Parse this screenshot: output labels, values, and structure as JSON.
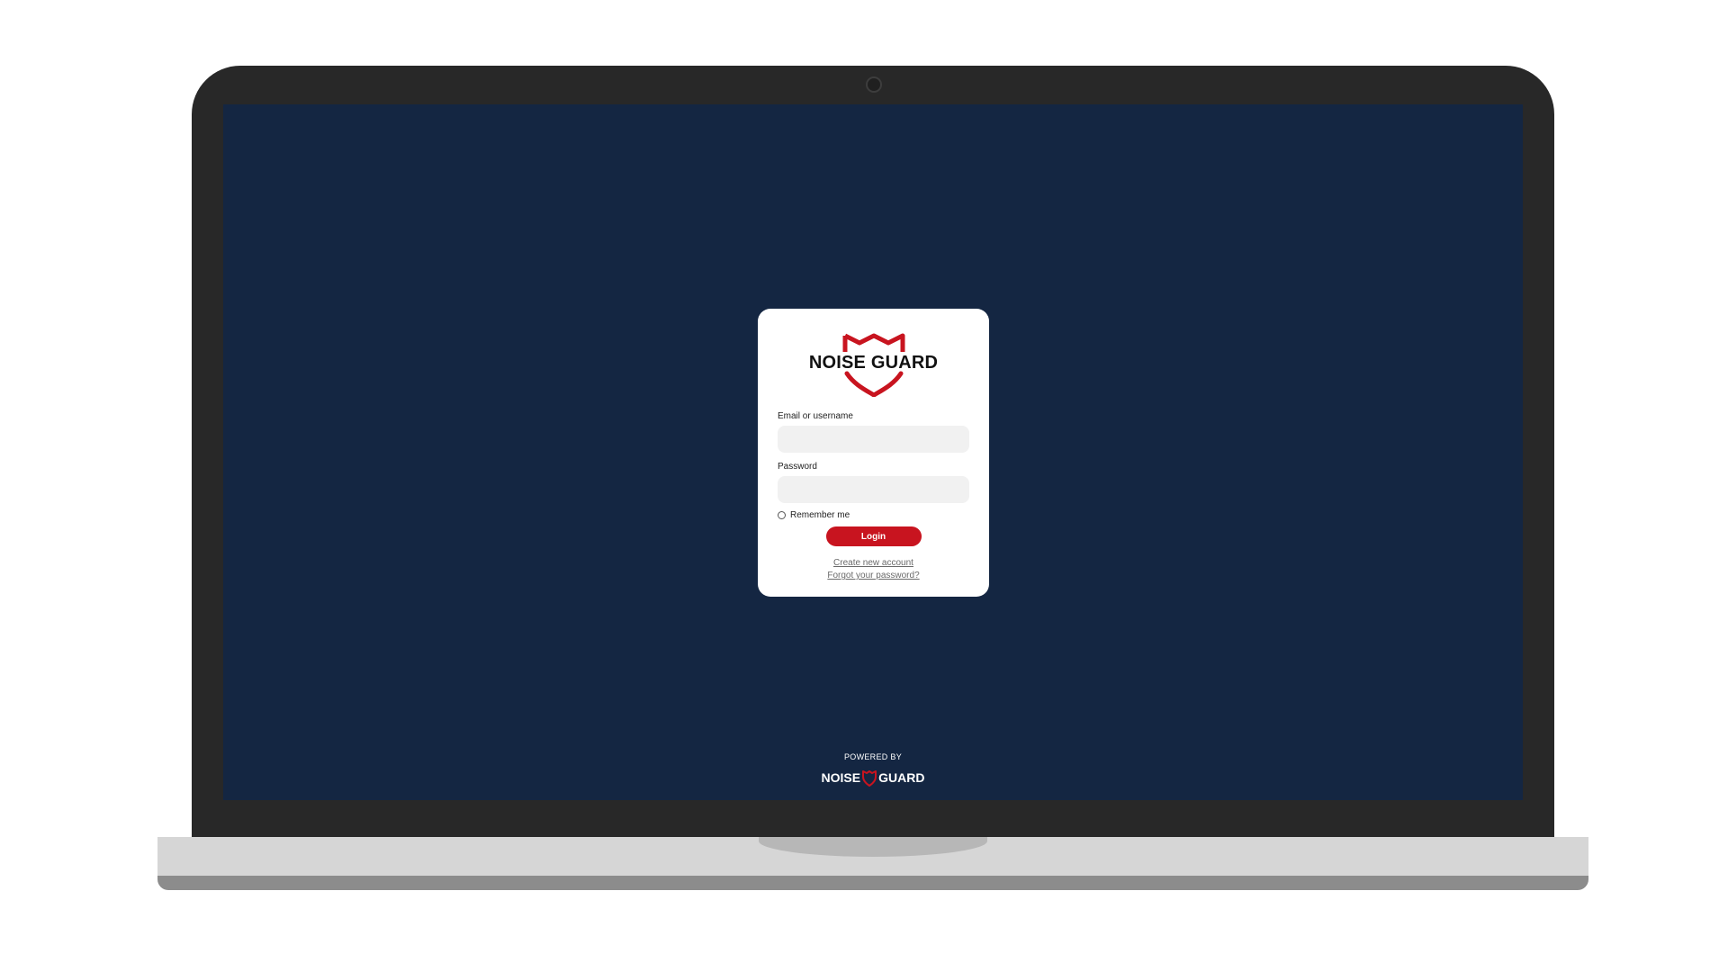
{
  "brand": {
    "name": "NOISE GUARD",
    "name_left": "NOISE",
    "name_right": "GUARD",
    "accent_color": "#c8141f",
    "logo_icon": "shield-icon"
  },
  "login_form": {
    "email_label": "Email or username",
    "email_value": "",
    "password_label": "Password",
    "password_value": "",
    "remember_label": "Remember me",
    "remember_checked": false,
    "login_label": "Login",
    "create_account_label": "Create new account",
    "forgot_password_label": "Forgot your password?"
  },
  "footer": {
    "powered_by": "POWERED BY"
  },
  "colors": {
    "screen_background": "#142642",
    "bezel": "#282828",
    "card": "#ffffff"
  }
}
